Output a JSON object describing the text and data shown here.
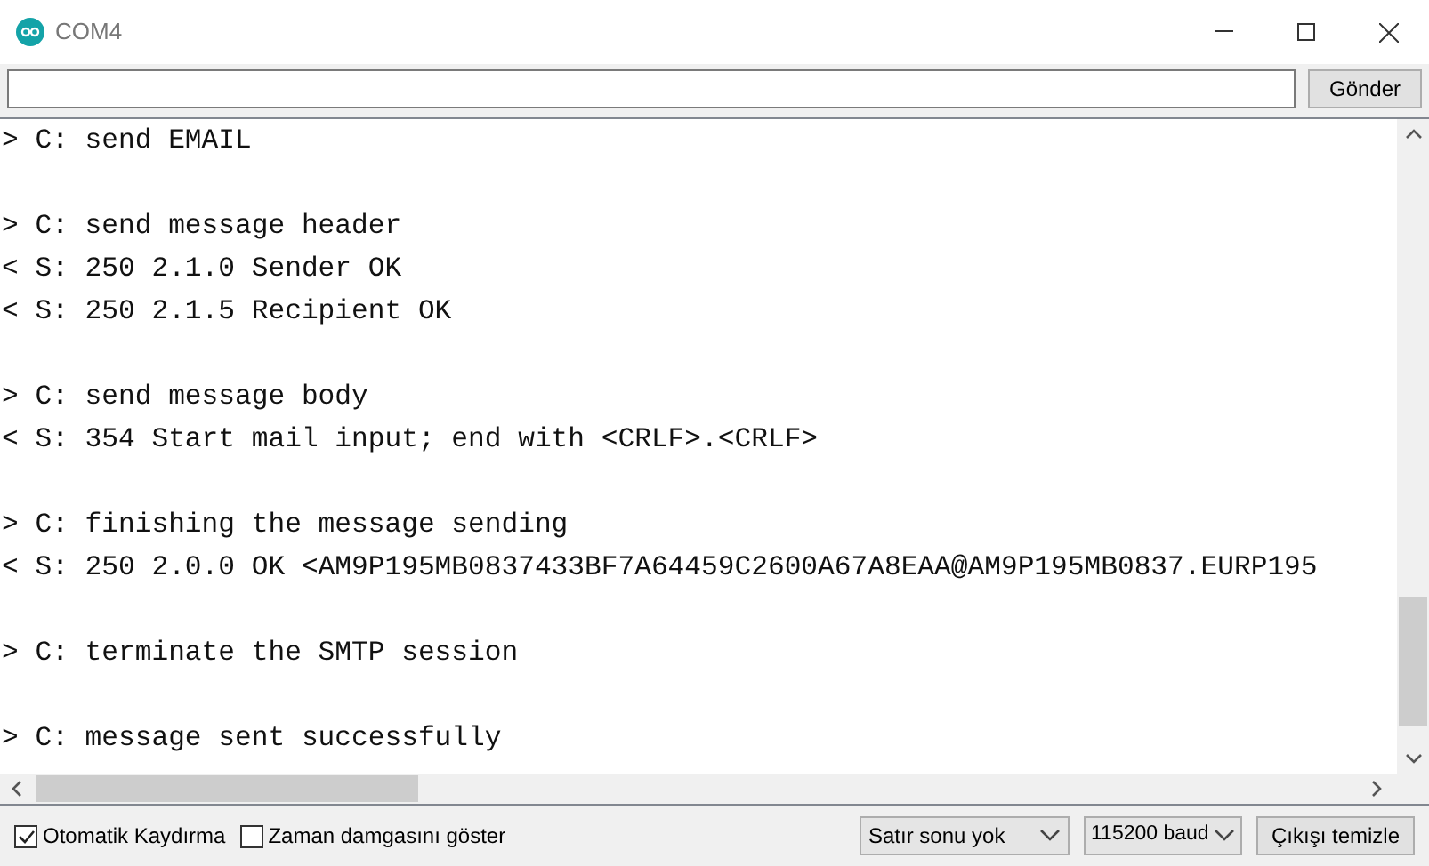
{
  "window": {
    "title": "COM4"
  },
  "send": {
    "button": "Gönder"
  },
  "output": [
    [
      "> C: send EMAIL"
    ],
    [
      "> C: send message header",
      "< S: 250 2.1.0 Sender OK",
      "< S: 250 2.1.5 Recipient OK"
    ],
    [
      "> C: send message body",
      "< S: 354 Start mail input; end with <CRLF>.<CRLF>"
    ],
    [
      "> C: finishing the message sending",
      "< S: 250 2.0.0 OK <AM9P195MB0837433BF7A64459C2600A67A8EAA@AM9P195MB0837.EURP195"
    ],
    [
      "> C: terminate the SMTP session"
    ],
    [
      "> C: message sent successfully"
    ]
  ],
  "options": [
    {
      "label": "Otomatik Kaydırma",
      "checked": true
    },
    {
      "label": "Zaman damgasını göster",
      "checked": false
    }
  ],
  "line_ending": "Satır sonu yok",
  "baud": "115200 baud",
  "clear_button": "Çıkışı temizle"
}
